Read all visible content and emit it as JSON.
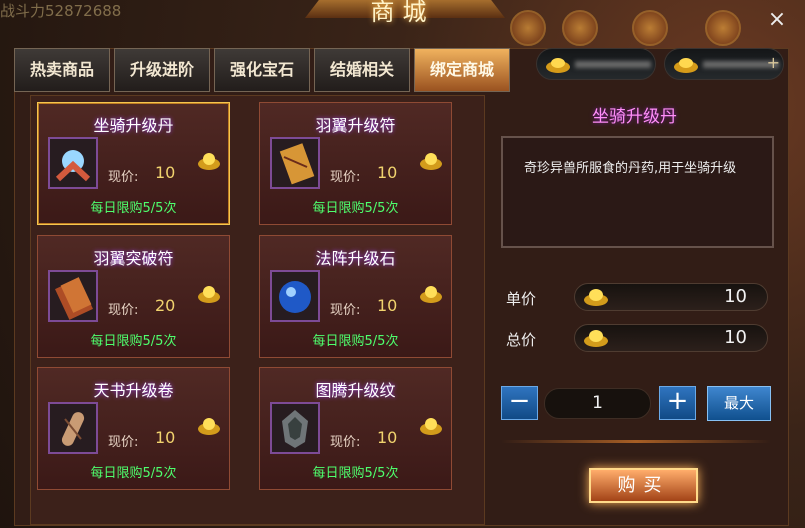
{
  "hud": {
    "power_text": "战斗力52872688"
  },
  "window": {
    "title": "商城",
    "close_label": "×"
  },
  "tabs": [
    "热卖商品",
    "升级进阶",
    "强化宝石",
    "结婚相关",
    "绑定商城"
  ],
  "items": [
    {
      "name": "坐骑升级丹",
      "price_label": "现价:",
      "price": "10",
      "limit": "每日限购5/5次",
      "icon": "mount-pill-icon"
    },
    {
      "name": "羽翼升级符",
      "price_label": "现价:",
      "price": "10",
      "limit": "每日限购5/5次",
      "icon": "wing-scroll-icon"
    },
    {
      "name": "羽翼突破符",
      "price_label": "现价:",
      "price": "20",
      "limit": "每日限购5/5次",
      "icon": "wing-breakthrough-icon"
    },
    {
      "name": "法阵升级石",
      "price_label": "现价:",
      "price": "10",
      "limit": "每日限购5/5次",
      "icon": "array-stone-icon"
    },
    {
      "name": "天书升级卷",
      "price_label": "现价:",
      "price": "10",
      "limit": "每日限购5/5次",
      "icon": "book-scroll-icon"
    },
    {
      "name": "图腾升级纹",
      "price_label": "现价:",
      "price": "10",
      "limit": "每日限购5/5次",
      "icon": "totem-icon"
    }
  ],
  "detail": {
    "name": "坐骑升级丹",
    "description": "奇珍异兽所服食的丹药,用于坐骑升级",
    "unit_label": "单价",
    "unit_price": "10",
    "total_label": "总价",
    "total_price": "10",
    "quantity": "1",
    "minus": "−",
    "plus": "+",
    "max": "最大",
    "buy": "购买"
  }
}
